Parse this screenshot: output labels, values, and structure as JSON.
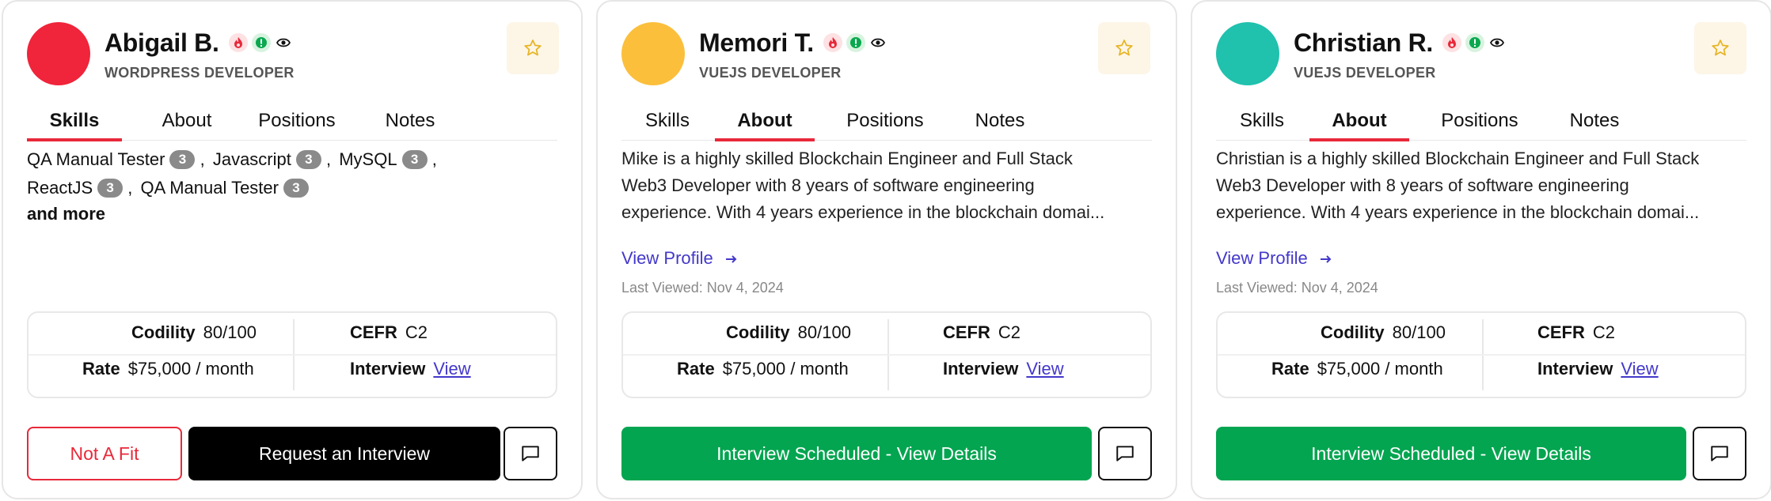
{
  "cards": [
    {
      "name": "Abigail B.",
      "role": "WORDPRESS DEVELOPER",
      "avatar_color": "#f0243a",
      "tabs": [
        "Skills",
        "About",
        "Positions",
        "Notes"
      ],
      "active_tab": "Skills",
      "skills": [
        {
          "label": "QA Manual Tester",
          "count": "3"
        },
        {
          "label": "Javascript",
          "count": "3"
        },
        {
          "label": "MySQL",
          "count": "3"
        },
        {
          "label": "ReactJS",
          "count": "3"
        },
        {
          "label": "QA Manual Tester",
          "count": "3"
        }
      ],
      "skills_more": "and more",
      "stats": {
        "codility_label": "Codility",
        "codility_value": "80/100",
        "cefr_label": "CEFR",
        "cefr_value": "C2",
        "rate_label": "Rate",
        "rate_value": "$75,000 / month",
        "interview_label": "Interview",
        "interview_link": "View"
      },
      "buttons": {
        "not_fit": "Not A Fit",
        "primary": "Request an Interview"
      }
    },
    {
      "name": "Memori T.",
      "role": "VUEJS DEVELOPER",
      "avatar_color": "#fbbf3c",
      "tabs": [
        "Skills",
        "About",
        "Positions",
        "Notes"
      ],
      "active_tab": "About",
      "about_lines": [
        "Mike is a highly skilled Blockchain Engineer and Full Stack",
        "Web3 Developer with 8 years of software engineering",
        "experience. With 4 years experience in the blockchain domai..."
      ],
      "view_profile": "View Profile",
      "last_viewed": "Last Viewed: Nov 4, 2024",
      "stats": {
        "codility_label": "Codility",
        "codility_value": "80/100",
        "cefr_label": "CEFR",
        "cefr_value": "C2",
        "rate_label": "Rate",
        "rate_value": "$75,000 / month",
        "interview_label": "Interview",
        "interview_link": "View"
      },
      "buttons": {
        "primary": "Interview Scheduled - View Details"
      }
    },
    {
      "name": "Christian R.",
      "role": "VUEJS DEVELOPER",
      "avatar_color": "#20c1ad",
      "tabs": [
        "Skills",
        "About",
        "Positions",
        "Notes"
      ],
      "active_tab": "About",
      "about_lines": [
        "Christian is a highly skilled Blockchain Engineer and Full Stack",
        "Web3 Developer with 8 years of software engineering",
        "experience. With 4 years experience in the blockchain domai..."
      ],
      "view_profile": "View Profile",
      "last_viewed": "Last Viewed: Nov 4, 2024",
      "stats": {
        "codility_label": "Codility",
        "codility_value": "80/100",
        "cefr_label": "CEFR",
        "cefr_value": "C2",
        "rate_label": "Rate",
        "rate_value": "$75,000 / month",
        "interview_label": "Interview",
        "interview_link": "View"
      },
      "buttons": {
        "primary": "Interview Scheduled - View Details"
      }
    }
  ],
  "colors": {
    "accent_red": "#e8293a",
    "link_blue": "#4338ca",
    "scheduled_green": "#04a550",
    "star_bg": "#fdf5e6",
    "star_stroke": "#e6b422"
  },
  "icons": {
    "fire": "fire-icon",
    "verified": "verified-icon",
    "eye": "eye-icon",
    "star": "star-icon",
    "arrow": "arrow-right-icon",
    "message": "message-icon"
  }
}
